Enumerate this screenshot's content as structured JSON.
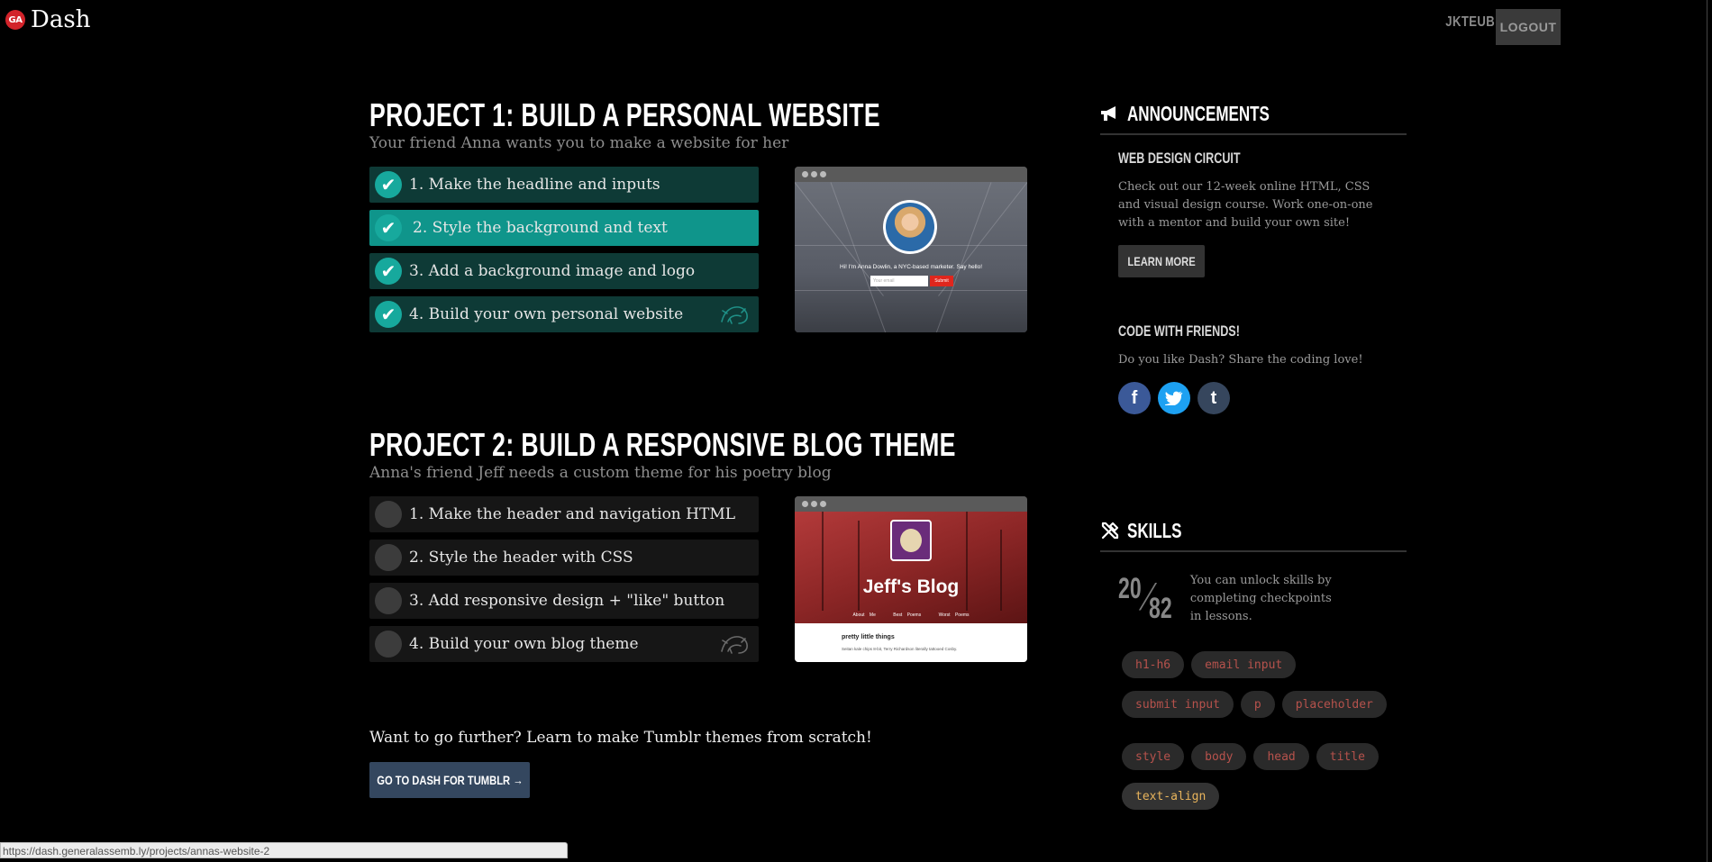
{
  "header": {
    "brand_badge": "GA",
    "brand_name": "Dash",
    "user_name": "JKTEUBER",
    "logout_label": "LOGOUT"
  },
  "project1": {
    "title": "PROJECT 1: BUILD A PERSONAL WEBSITE",
    "subtitle": "Your friend Anna wants you to make a website for her",
    "steps": [
      {
        "label": "1. Make the headline and inputs",
        "status": "done"
      },
      {
        "label": "2. Style the background and text",
        "status": "active"
      },
      {
        "label": "3. Add a background image and logo",
        "status": "done"
      },
      {
        "label": "4. Build your own personal website",
        "status": "done"
      }
    ],
    "preview": {
      "caption": "Hi! I'm Anna Dowlin, a NYC-based marketer. Say hello!",
      "input_placeholder": "Your email",
      "submit_label": "Submit"
    }
  },
  "project2": {
    "title": "PROJECT 2: BUILD A RESPONSIVE BLOG THEME",
    "subtitle": "Anna's friend Jeff needs a custom theme for his poetry blog",
    "steps": [
      {
        "label": "1. Make the header and navigation HTML",
        "status": "todo"
      },
      {
        "label": "2. Style the header with CSS",
        "status": "todo"
      },
      {
        "label": "3. Add responsive design + \"like\" button",
        "status": "todo"
      },
      {
        "label": "4. Build your own blog theme",
        "status": "todo"
      }
    ],
    "preview": {
      "blog_title": "Jeff's Blog",
      "nav": [
        "About Me",
        "Best Poems",
        "Worst Poems"
      ],
      "post_title": "pretty little things",
      "post_text": "Seitan kale chips 8-bit, Terry Richardson literally tattooed Cosby."
    }
  },
  "further": {
    "text": "Want to go further? Learn to make Tumblr themes from scratch!",
    "button_label": "GO TO DASH FOR TUMBLR →"
  },
  "status_url": "https://dash.generalassemb.ly/projects/annas-website-2",
  "sidebar": {
    "announcements_title": "ANNOUNCEMENTS",
    "circuit_title": "WEB DESIGN CIRCUIT",
    "circuit_text": "Check out our 12-week online HTML, CSS and visual design course. Work one-on-one with a mentor and build your own site!",
    "learn_more_label": "LEARN MORE",
    "friends_title": "CODE WITH FRIENDS!",
    "friends_text": "Do you like Dash? Share the coding love!",
    "social": [
      "f",
      "t",
      "t"
    ],
    "skills_title": "SKILLS",
    "skills_unlocked": "20",
    "skills_total": "82",
    "skills_text": "You can unlock skills by completing checkpoints in lessons.",
    "tags": [
      {
        "label": "h1-h6",
        "state": "locked"
      },
      {
        "label": "email input",
        "state": "locked"
      },
      {
        "label": "submit input",
        "state": "locked"
      },
      {
        "label": "p",
        "state": "locked"
      },
      {
        "label": "placeholder",
        "state": "locked"
      },
      {
        "label": "style",
        "state": "locked"
      },
      {
        "label": "body",
        "state": "locked"
      },
      {
        "label": "head",
        "state": "locked"
      },
      {
        "label": "title",
        "state": "locked"
      },
      {
        "label": "text-align",
        "state": "unlocked"
      }
    ]
  },
  "colors": {
    "accent_teal": "#0f958b",
    "done_teal": "#0e3a36",
    "brand_red": "#d2232a",
    "tag_locked_text": "#b6524c",
    "tag_unlocked_text": "#e8b45c"
  }
}
